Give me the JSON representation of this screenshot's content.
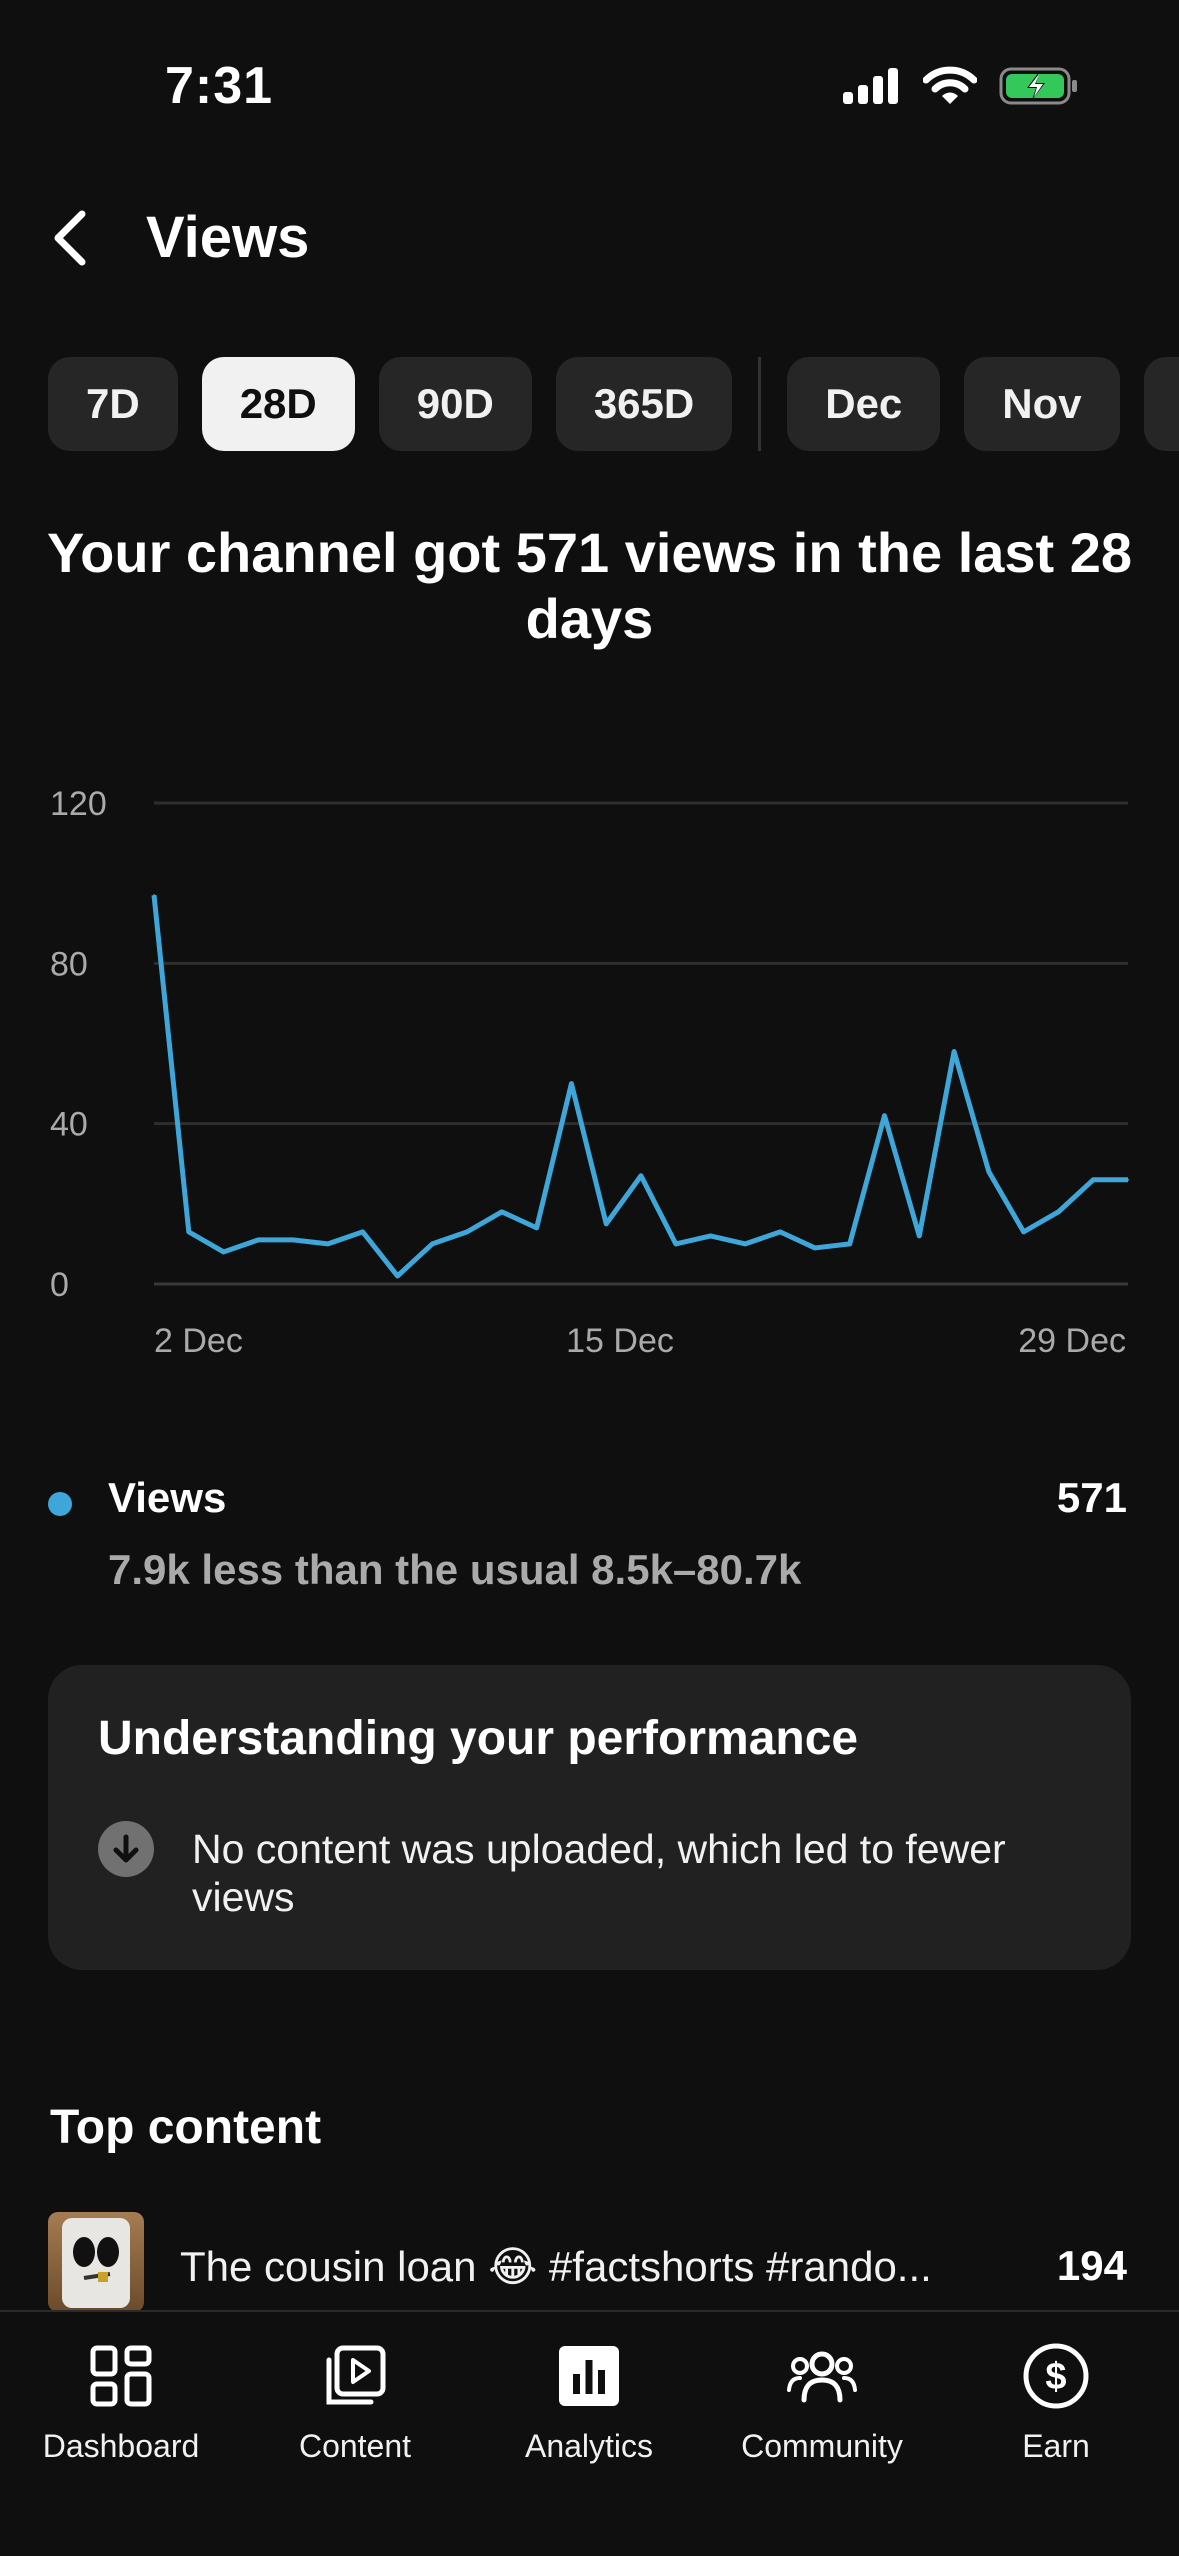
{
  "status_bar": {
    "time": "7:31"
  },
  "header": {
    "title": "Views"
  },
  "chips": [
    "7D",
    "28D",
    "90D",
    "365D",
    "Dec",
    "Nov"
  ],
  "headline": "Your channel got 571 views in the last 28 days",
  "chart_data": {
    "type": "line",
    "x": [
      "1 Dec",
      "2 Dec",
      "3 Dec",
      "4 Dec",
      "5 Dec",
      "6 Dec",
      "7 Dec",
      "8 Dec",
      "9 Dec",
      "10 Dec",
      "11 Dec",
      "12 Dec",
      "13 Dec",
      "14 Dec",
      "15 Dec",
      "16 Dec",
      "17 Dec",
      "18 Dec",
      "19 Dec",
      "20 Dec",
      "21 Dec",
      "22 Dec",
      "23 Dec",
      "24 Dec",
      "25 Dec",
      "26 Dec",
      "27 Dec",
      "28 Dec",
      "29 Dec"
    ],
    "series": [
      {
        "name": "Views",
        "values": [
          97,
          13,
          8,
          11,
          11,
          10,
          13,
          2,
          10,
          13,
          18,
          14,
          50,
          15,
          27,
          10,
          12,
          10,
          13,
          9,
          10,
          42,
          12,
          58,
          28,
          13,
          18,
          26,
          26
        ]
      }
    ],
    "yticks": [
      "0",
      "40",
      "80",
      "120"
    ],
    "xticks": [
      "2 Dec",
      "15 Dec",
      "29 Dec"
    ],
    "ylim": [
      0,
      120
    ],
    "color": "#3ea6d8",
    "grid": true
  },
  "legend": {
    "name": "Views",
    "value": "571",
    "comparison": "7.9k less than the usual 8.5k–80.7k"
  },
  "insight": {
    "title": "Understanding your performance",
    "text": "No content was uploaded, which led to fewer views",
    "icon": "arrow-down-circle-icon"
  },
  "top_content": {
    "title": "Top content",
    "items": [
      {
        "title": "The cousin loan 😂 #factshorts #rando...",
        "value": "194"
      }
    ]
  },
  "bottom_nav": [
    {
      "label": "Dashboard",
      "icon": "dashboard-icon"
    },
    {
      "label": "Content",
      "icon": "content-icon"
    },
    {
      "label": "Analytics",
      "icon": "analytics-icon"
    },
    {
      "label": "Community",
      "icon": "community-icon"
    },
    {
      "label": "Earn",
      "icon": "earn-icon"
    }
  ]
}
